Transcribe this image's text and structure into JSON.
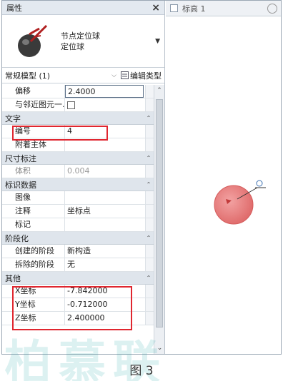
{
  "palette": {
    "title": "属性",
    "close": "×",
    "type": {
      "name1": "节点定位球",
      "name2": "定位球"
    },
    "instance": {
      "label": "常规模型 (1)",
      "edit_label": "编辑类型"
    }
  },
  "props": {
    "offset": {
      "label": "偏移",
      "value": "2.4000"
    },
    "move_with": {
      "label": "与邻近图元一..."
    },
    "group_text": "文字",
    "number": {
      "label": "编号",
      "value": "4"
    },
    "host": {
      "label": "附着主体",
      "value": ""
    },
    "group_dim": "尺寸标注",
    "volume": {
      "label": "体积",
      "value": "0.004"
    },
    "group_id": "标识数据",
    "image": {
      "label": "图像",
      "value": ""
    },
    "comments": {
      "label": "注释",
      "value": "坐标点"
    },
    "mark": {
      "label": "标记",
      "value": ""
    },
    "group_phase": "阶段化",
    "phase_created": {
      "label": "创建的阶段",
      "value": "新构造"
    },
    "phase_demolished": {
      "label": "拆除的阶段",
      "value": "无"
    },
    "group_other": "其他",
    "x": {
      "label": "X坐标",
      "value": "-7.842000"
    },
    "y": {
      "label": "Y坐标",
      "value": "-0.712000"
    },
    "z": {
      "label": "Z坐标",
      "value": "2.400000"
    }
  },
  "view": {
    "tab_label": "标高 1"
  },
  "caption": "图 3",
  "watermark": "柏慕联",
  "colors": {
    "highlight": "#e0262f",
    "sphere": "#e98080"
  }
}
